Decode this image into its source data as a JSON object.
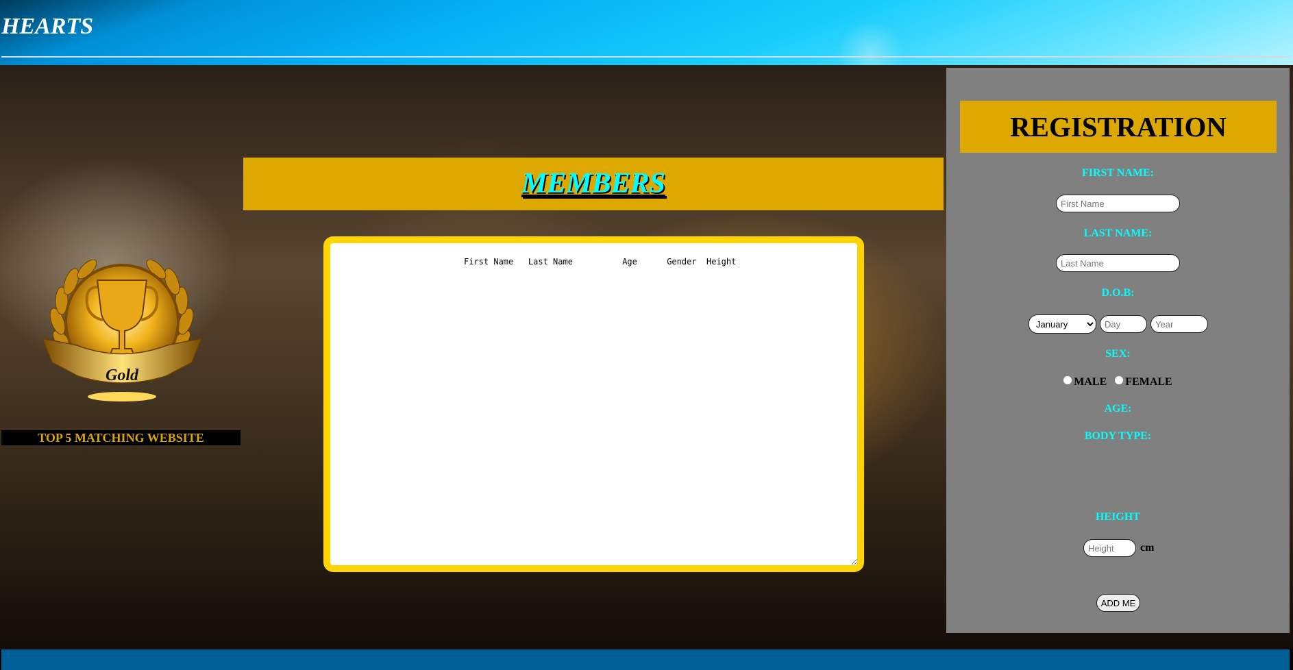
{
  "header": {
    "title": "HEARTS"
  },
  "members": {
    "title": "MEMBERS",
    "columns_line": "First Name   Last Name          Age      Gender  Height"
  },
  "badge": {
    "text": "Gold",
    "caption": "TOP 5 MATCHING WEBSITE"
  },
  "registration": {
    "title": "REGISTRATION",
    "first_name_label": "FIRST NAME:",
    "first_name_placeholder": "First Name",
    "last_name_label": "LAST NAME:",
    "last_name_placeholder": "Last Name",
    "dob_label": "D.O.B:",
    "month_selected": "January",
    "day_placeholder": "Day",
    "year_placeholder": "Year",
    "sex_label": "SEX:",
    "male": "MALE",
    "female": "FEMALE",
    "age_label": "AGE:",
    "body_type_label": "BODY TYPE:",
    "height_label": "HEIGHT",
    "height_placeholder": "Height",
    "height_unit": "cm",
    "submit": "ADD ME"
  },
  "colors": {
    "accent": "#dda900",
    "label": "#00ffff",
    "panel": "#808080",
    "footer": "#005f96",
    "box_border": "#ffd400"
  }
}
